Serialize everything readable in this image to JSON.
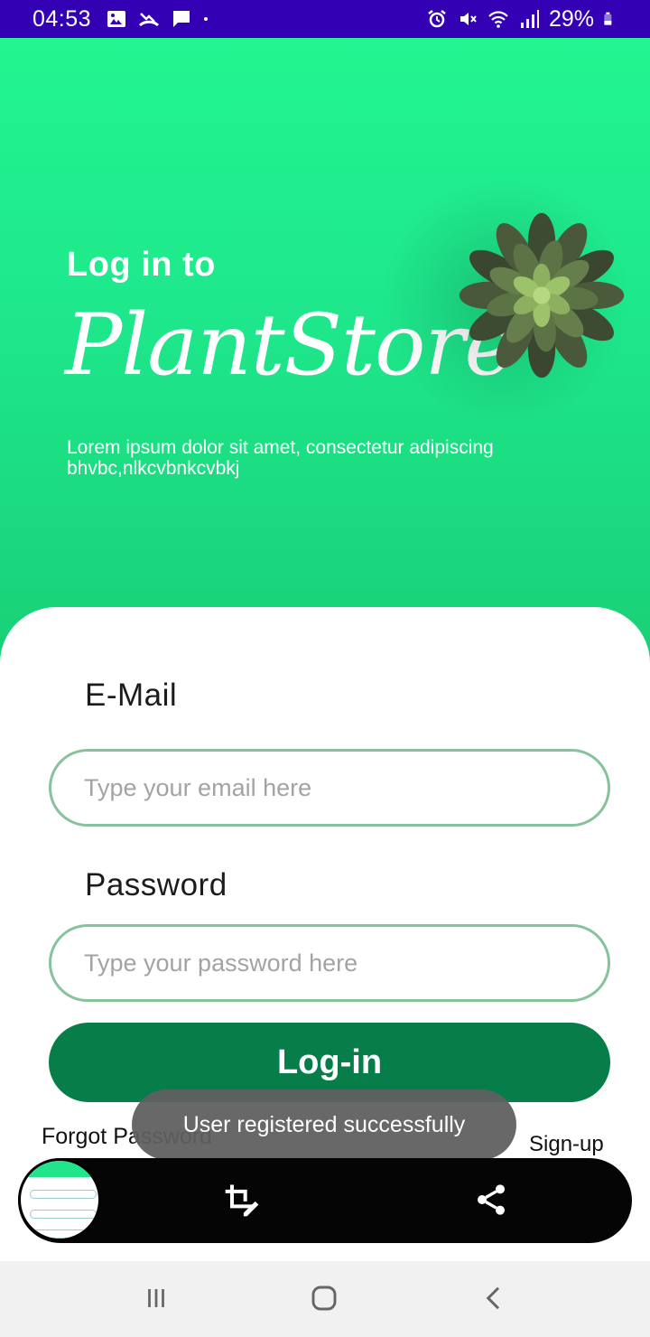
{
  "status_bar": {
    "time": "04:53",
    "battery": "29%",
    "icons_left": [
      "image-icon",
      "missed-call-icon",
      "chat-icon",
      "dot-icon"
    ],
    "icons_right": [
      "alarm-icon",
      "mute-icon",
      "wifi-icon",
      "signal-icon",
      "battery-icon"
    ]
  },
  "hero": {
    "heading_small": "Log in to",
    "heading_big": "PlantStore",
    "description": "Lorem ipsum dolor sit amet, consectetur adipiscing bhvbc,nlkcvbnkcvbkj",
    "colors": {
      "gradient_top": "#22f591",
      "gradient_bottom": "#19cf76"
    }
  },
  "form": {
    "email_label": "E-Mail",
    "email_placeholder": "Type your email here",
    "email_value": "",
    "password_label": "Password",
    "password_placeholder": "Type your password here",
    "password_value": "",
    "login_label": "Log-in",
    "forgot_label": "Forgot Password",
    "signup_label": "Sign-up",
    "colors": {
      "field_border": "#86c39c",
      "button": "#077d4a"
    }
  },
  "toast": {
    "message": "User registered successfully"
  },
  "screenshot_toolbar": {
    "icons": [
      "screenshot-thumbnail",
      "crop-edit-icon",
      "share-icon"
    ]
  },
  "nav_bar": {
    "icons": [
      "recent-apps-icon",
      "home-icon",
      "back-icon"
    ]
  }
}
